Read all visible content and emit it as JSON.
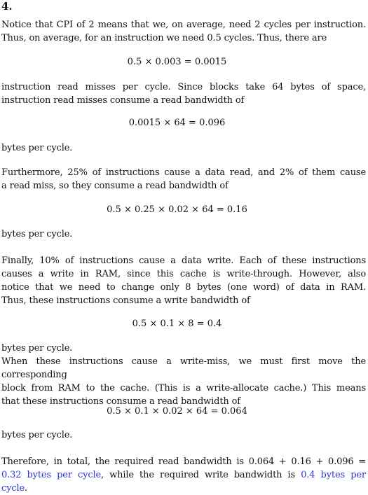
{
  "heading": "4.",
  "p1": {
    "line1": "Notice that CPI of 2 means that we, on average, need 2 cycles per instruction.",
    "line2": "Thus, on average, for an instruction we need 0.5 cycles. Thus, there are"
  },
  "eq1": "0.5 × 0.003 = 0.0015",
  "p2": {
    "line1": "instruction read misses per cycle. Since blocks take 64 bytes of space,",
    "line2": "instruction read misses consume a read bandwidth of"
  },
  "eq2": "0.0015 × 64 = 0.096",
  "p3": "bytes per cycle.",
  "p4": {
    "line1": "Furthermore, 25% of instructions cause a data read, and 2% of them cause",
    "line2": "a read miss, so they consume a read bandwidth of"
  },
  "eq3": "0.5 × 0.25 × 0.02 × 64 = 0.16",
  "p5": "bytes per cycle.",
  "p6": {
    "line1": "Finally, 10% of instructions cause a data write. Each of these instructions",
    "line2": "causes a write in RAM, since this cache is write-through. However, also",
    "line3": "notice that we need to change only 8 bytes (one word) of data in RAM.",
    "line4": "Thus, these instructions consume a write bandwidth of"
  },
  "eq4": "0.5 × 0.1 × 8 = 0.4",
  "p7": {
    "line1": "bytes per cycle.",
    "line2": "When these instructions cause a write-miss, we must first move the corresponding",
    "line3": "block from RAM to the cache. (This is a write-allocate cache.) This means",
    "line4": "that these instructions consume a read bandwidth of"
  },
  "eq5": "0.5 × 0.1 × 0.02 × 64 = 0.064",
  "p8": "bytes per cycle.",
  "p9": {
    "line1": "Therefore, in total, the required read bandwidth is 0.064 + 0.16 + 0.096 =",
    "answer_read": "0.32 bytes per cycle",
    "mid": ", while the required write bandwidth is ",
    "answer_write_1": "0.4 bytes per",
    "answer_write_2": "cycle",
    "end": "."
  },
  "colors": {
    "answer": "#2a35d6",
    "text": "#111111"
  }
}
